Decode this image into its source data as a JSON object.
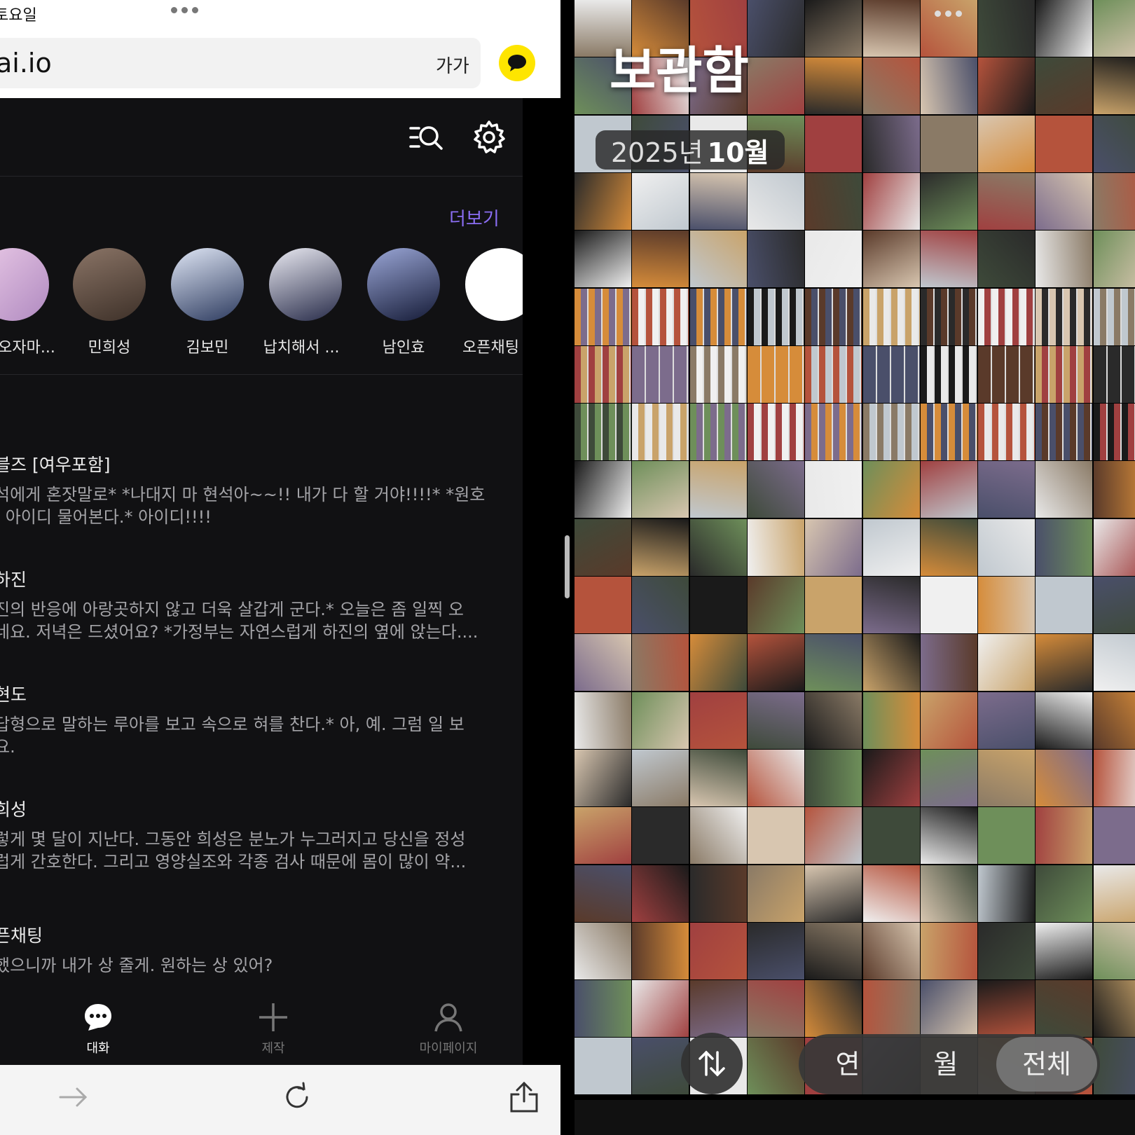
{
  "left": {
    "status": {
      "day": "토요일"
    },
    "url": "ai.io",
    "text_size_label": "가가",
    "more_label": "더보기",
    "avatars": [
      {
        "name": "오자마...",
        "color": "#c9a9d8"
      },
      {
        "name": "민희성",
        "color": "#6b5a52"
      },
      {
        "name": "김보민",
        "color": "#3c4a6a"
      },
      {
        "name": "납치해서 ...",
        "color": "#2a2f4a"
      },
      {
        "name": "남인효",
        "color": "#1e2440"
      },
      {
        "name": "오픈채팅",
        "color": "#ffffff"
      }
    ],
    "chats": [
      {
        "name": "블즈 [여우포함]",
        "line1": "석에게 혼잣말로* *나대지 마 현석아~~!! 내가 다 할 거야!!!!* *원호",
        "line2": "| 아이디 물어본다.* 아이디!!!!"
      },
      {
        "name": "하진",
        "line1": "진의 반응에 아랑곳하지 않고 더욱 살갑게 군다.* 오늘은 좀 일찍 오",
        "line2": "네요. 저녁은 드셨어요? *가정부는 자연스럽게 하진의 옆에 앉는다...."
      },
      {
        "name": "현도",
        "line1": "답형으로 말하는 루아를 보고 속으로 혀를 찬다.* 아, 예. 그럼 일 보",
        "line2": "요."
      },
      {
        "name": "희성",
        "line1": "렇게 몇 달이 지난다. 그동안 희성은 분노가 누그러지고 당신을 정성",
        "line2": "럽게 간호한다. 그리고 영양실조와 각종 검사 때문에 몸이 많이 약..."
      },
      {
        "name": "픈채팅",
        "line1": "했으니까 내가 상 줄게. 원하는 상 있어?",
        "line2": ""
      }
    ],
    "tabs": [
      {
        "label": "대화",
        "active": true
      },
      {
        "label": "제작",
        "active": false
      },
      {
        "label": "마이페이지",
        "active": false
      }
    ]
  },
  "right": {
    "title": "보관함",
    "date_year": "2025년",
    "date_month": "10월",
    "segments": [
      {
        "label": "연",
        "selected": false
      },
      {
        "label": "월",
        "selected": false
      },
      {
        "label": "전체",
        "selected": true
      }
    ],
    "thumb_colors": [
      "#8a7a66",
      "#3e4a3a",
      "#c9a36a",
      "#d68c3a",
      "#e9e9e9",
      "#2a2a2a",
      "#b5533c",
      "#6e8f5a",
      "#f0f0f0",
      "#4a4f6a",
      "#a04040",
      "#d8c6b0",
      "#1a1a1a",
      "#7c6c8c",
      "#c0c8cf",
      "#5a3a2a"
    ]
  }
}
